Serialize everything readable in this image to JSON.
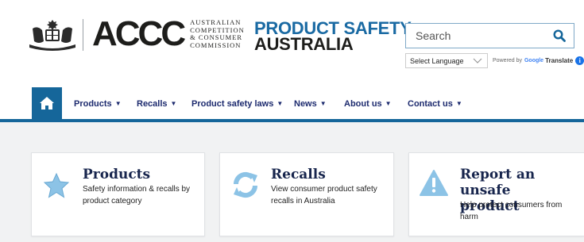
{
  "header": {
    "agency_logo": {
      "letters": "ACCC",
      "sub_lines": [
        "AUSTRALIAN",
        "COMPETITION",
        "& CONSUMER",
        "COMMISSION"
      ]
    },
    "site_title": {
      "line1": "PRODUCT SAFETY",
      "line2": "AUSTRALIA"
    },
    "search": {
      "placeholder": "Search"
    },
    "language": {
      "selected": "Select Language",
      "powered_by": "Powered by",
      "google": "Google",
      "translate": "Translate"
    }
  },
  "nav": {
    "items": [
      {
        "label": "Products"
      },
      {
        "label": "Recalls"
      },
      {
        "label": "Product safety laws"
      },
      {
        "label": "News"
      },
      {
        "label": "About us"
      },
      {
        "label": "Contact us"
      }
    ]
  },
  "cards": [
    {
      "title": "Products",
      "desc_line1": "Safety information & recalls by",
      "desc_line2": "product category",
      "icon": "star-icon"
    },
    {
      "title": "Recalls",
      "desc_line1": "View consumer product safety",
      "desc_line2": "recalls in Australia",
      "icon": "refresh-icon"
    },
    {
      "title_line1": "Report an unsafe",
      "title_line2": "product",
      "desc_line1": "Help protect consumers from",
      "desc_line2": "harm",
      "icon": "warning-icon"
    }
  ],
  "colors": {
    "brand_blue": "#15669a",
    "nav_text": "#1c2a6e",
    "card_title": "#17254d",
    "icon_light_blue": "#8cc3e6"
  }
}
